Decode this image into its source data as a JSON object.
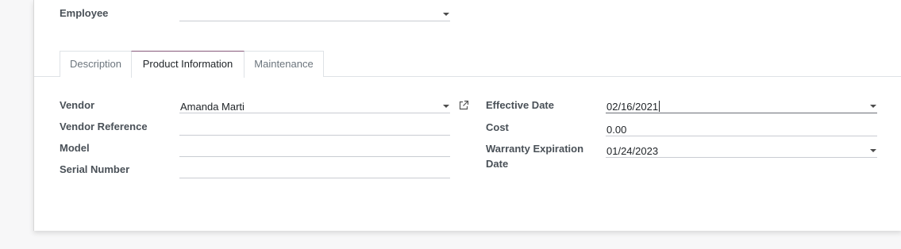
{
  "employee": {
    "label": "Employee",
    "value": ""
  },
  "tabs": [
    {
      "label": "Description",
      "active": false
    },
    {
      "label": "Product Information",
      "active": true
    },
    {
      "label": "Maintenance",
      "active": false
    }
  ],
  "left_fields": {
    "vendor": {
      "label": "Vendor",
      "value": "Amanda Marti"
    },
    "vendor_reference": {
      "label": "Vendor Reference",
      "value": ""
    },
    "model": {
      "label": "Model",
      "value": ""
    },
    "serial_number": {
      "label": "Serial Number",
      "value": ""
    }
  },
  "right_fields": {
    "effective_date": {
      "label": "Effective Date",
      "value": "02/16/2021"
    },
    "cost": {
      "label": "Cost",
      "value": "0.00"
    },
    "warranty_expiration": {
      "label_line1": "Warranty Expiration",
      "label_line2": "Date",
      "value": "01/24/2023"
    }
  },
  "colors": {
    "accent": "#875a7b",
    "label": "#495057",
    "border": "#c9ccd2"
  },
  "icons": {
    "external_link": "external-link-icon",
    "dropdown": "caret-down-icon"
  }
}
